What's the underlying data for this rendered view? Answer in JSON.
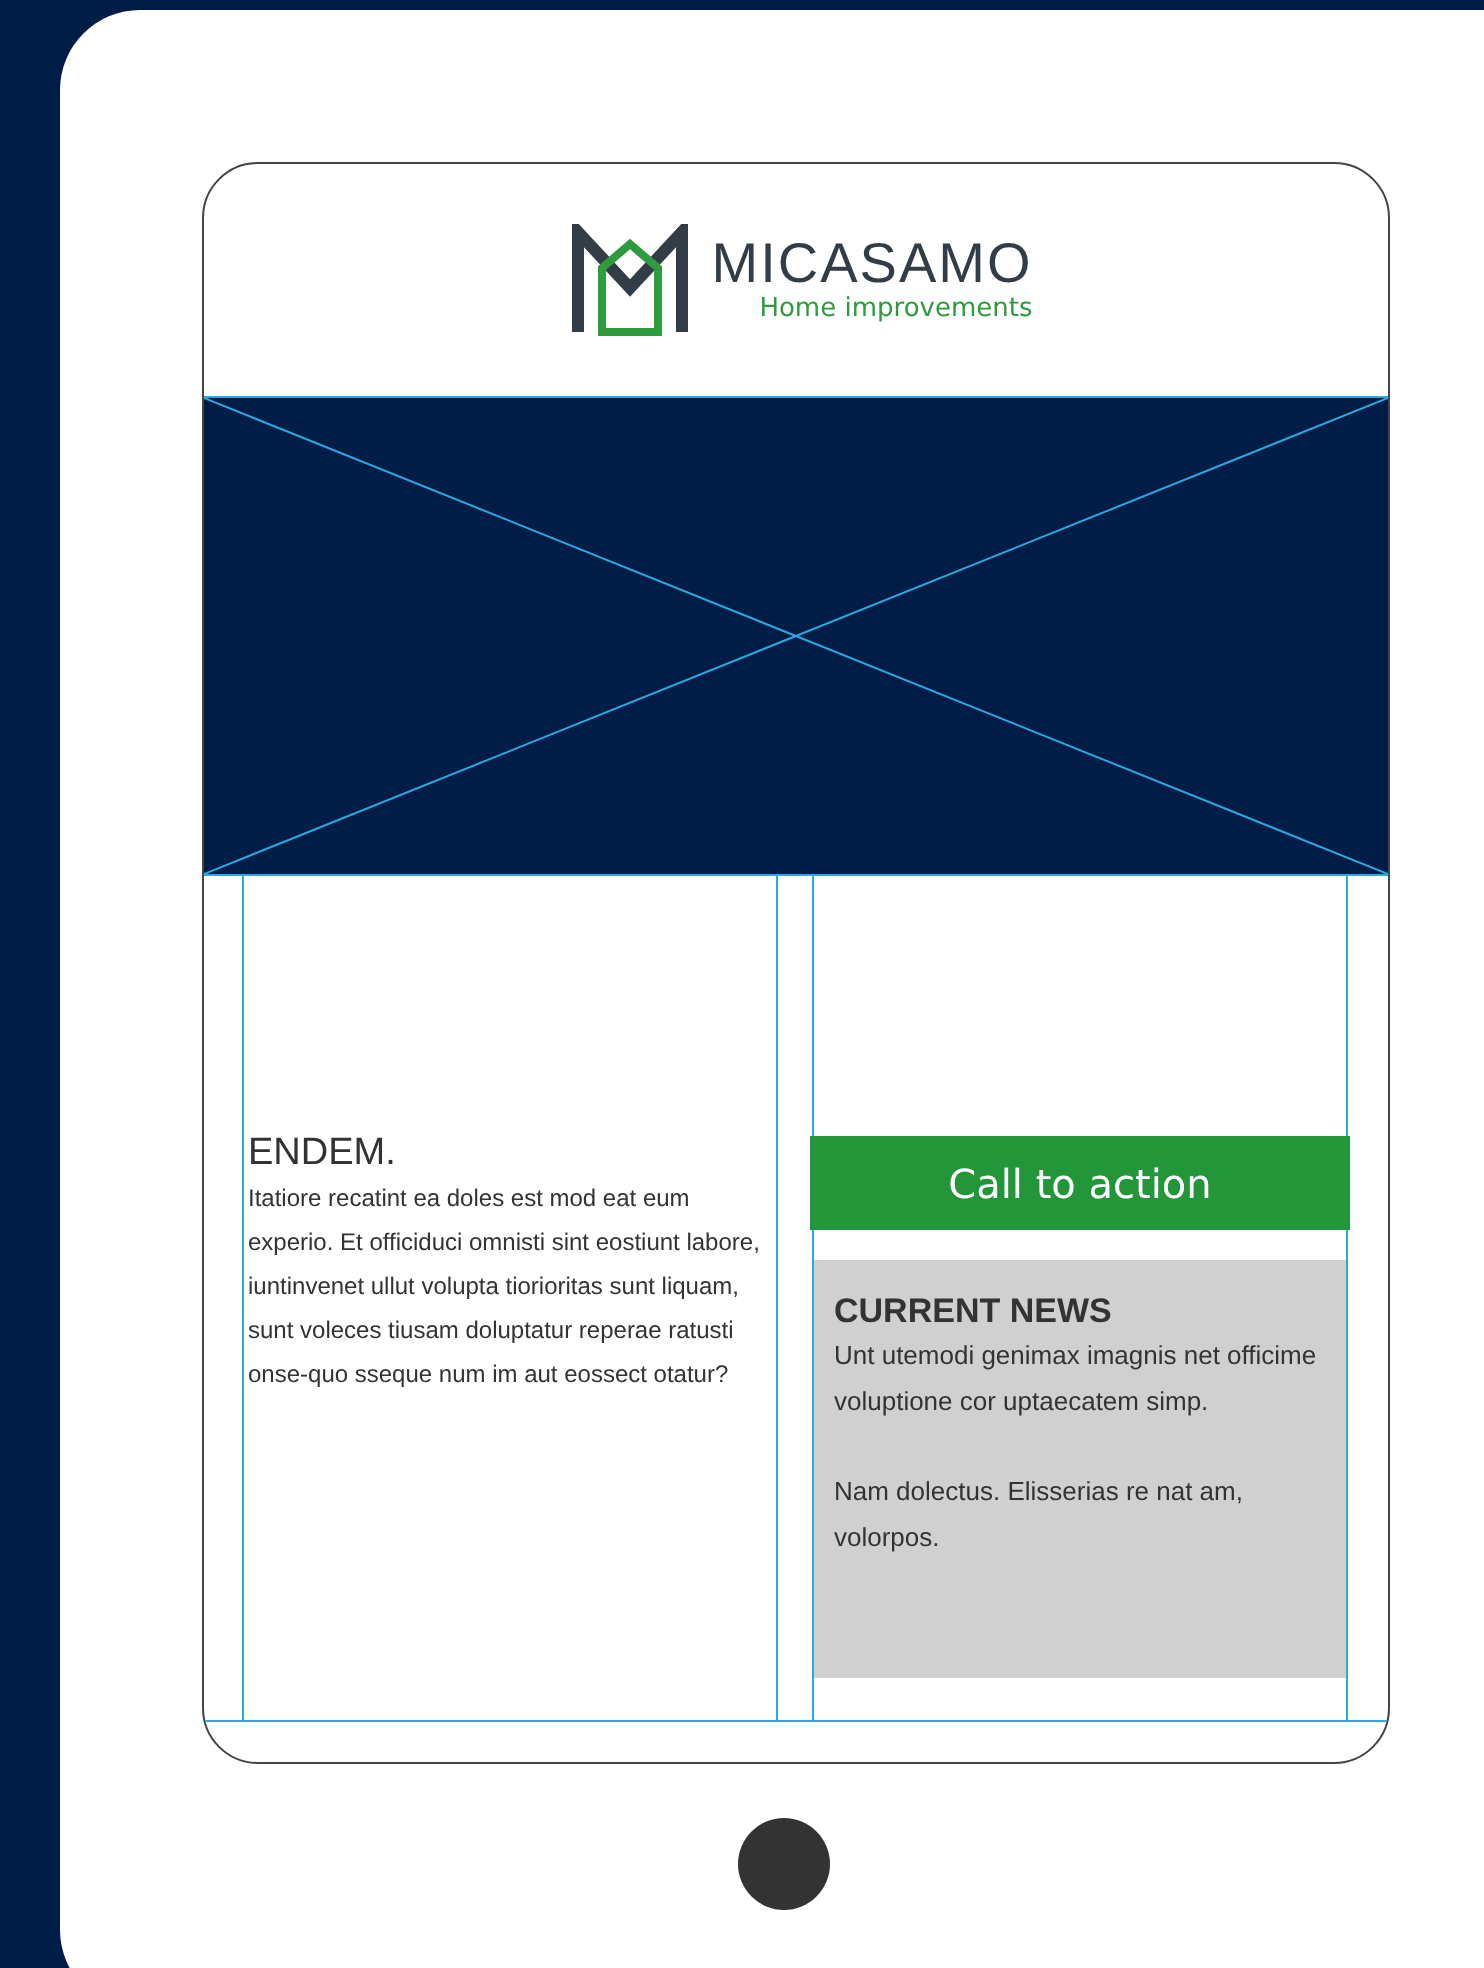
{
  "header": {
    "brand": "MICASAMO",
    "tagline": "Home improvements"
  },
  "hero": {
    "kind": "placeholder"
  },
  "intro": {
    "heading": "ENDEM.",
    "text": "Itatiore recatint ea doles est mod eat eum experio. Et officiduci omnisti sint eostiunt labore, iuntinvenet ullut volupta tiorioritas sunt liquam, sunt voleces tiusam doluptatur reperae ratusti onse-quo sseque num im aut eossect otatur?"
  },
  "cta": {
    "label": "Call to action"
  },
  "news": {
    "heading": "CURRENT NEWS",
    "paragraphs": [
      "Unt utemodi genimax imagnis net officime voluptione cor uptaecatem simp.",
      "Nam dolectus. Elisserias re nat am, volorpos."
    ]
  }
}
